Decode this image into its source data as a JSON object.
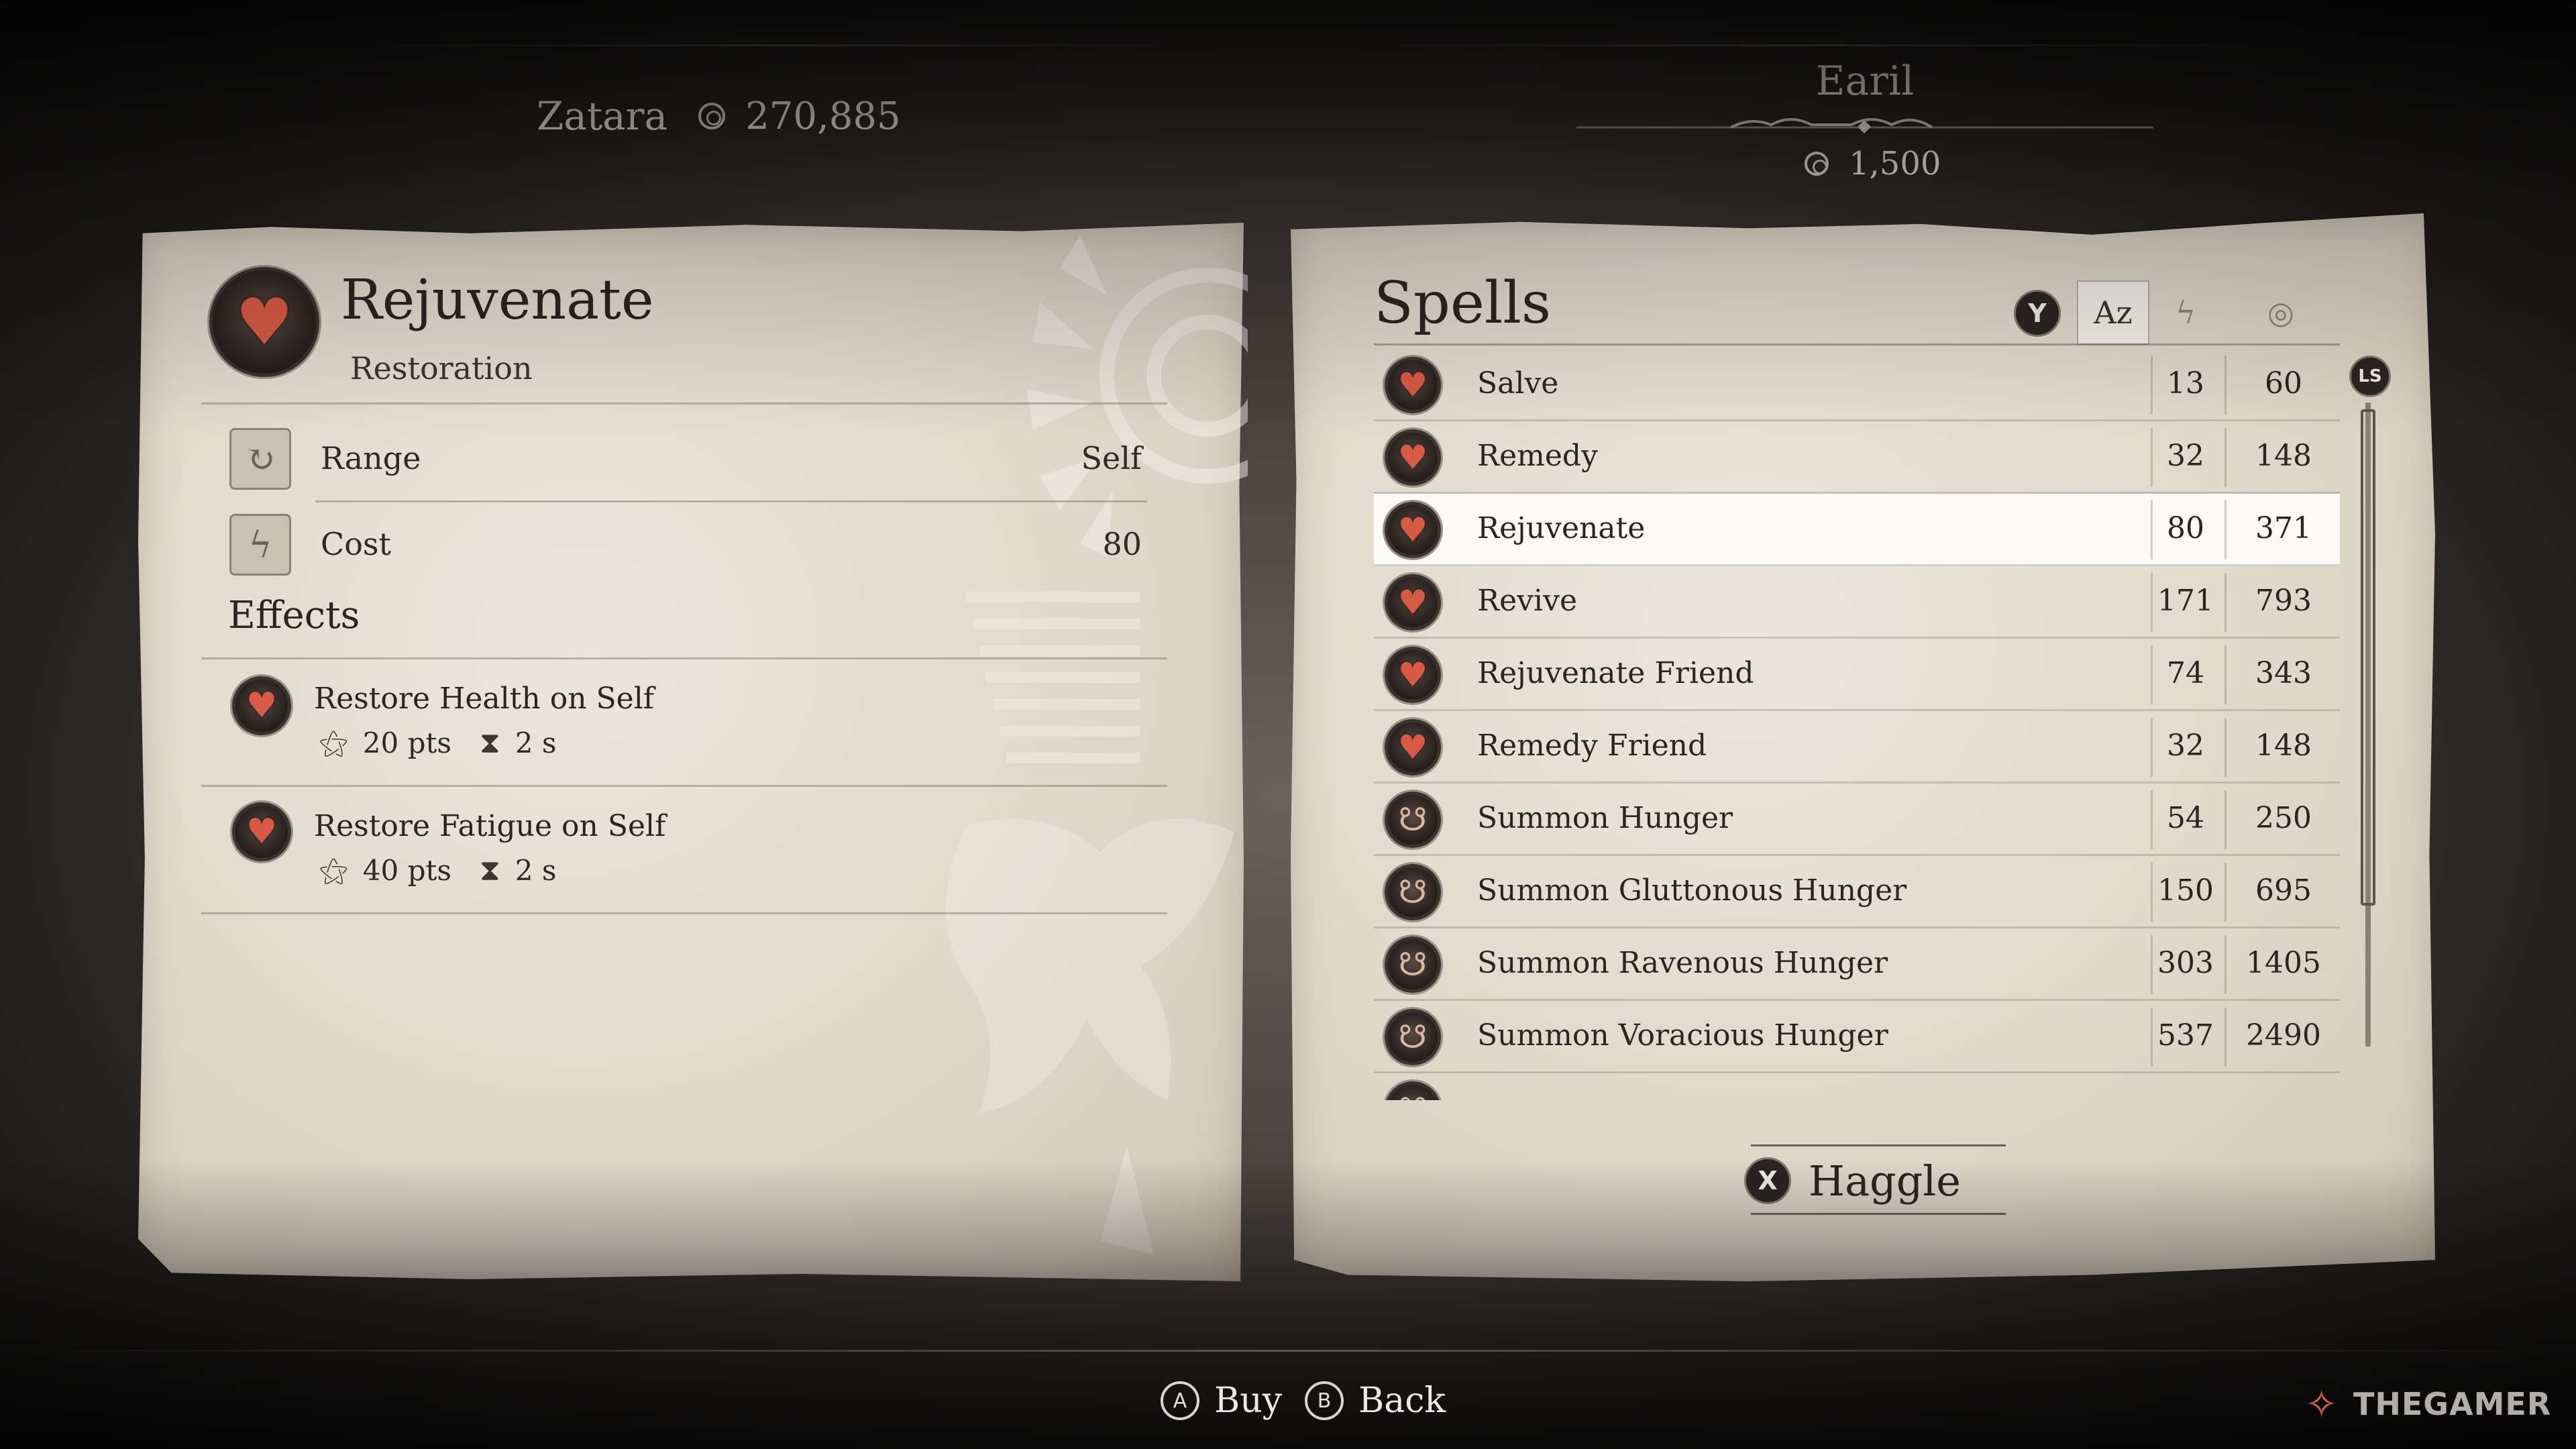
{
  "player": {
    "name": "Zatara",
    "gold": "270,885"
  },
  "merchant": {
    "name": "Earil",
    "gold": "1,500"
  },
  "selected_spell": {
    "name": "Rejuvenate",
    "school": "Restoration",
    "attributes": [
      {
        "label": "Range",
        "value": "Self",
        "icon": "range-icon"
      },
      {
        "label": "Cost",
        "value": "80",
        "icon": "lightning-icon"
      }
    ],
    "effects_heading": "Effects",
    "effects": [
      {
        "name": "Restore Health on Self",
        "magnitude": "20 pts",
        "duration": "2 s"
      },
      {
        "name": "Restore Fatigue on Self",
        "magnitude": "40 pts",
        "duration": "2 s"
      }
    ]
  },
  "spell_list": {
    "title": "Spells",
    "sort_button": "Y",
    "sort_tabs": [
      {
        "icon": "sort-alpha-icon",
        "glyph": "Az",
        "active": true
      },
      {
        "icon": "lightning-icon",
        "glyph": "ϟ",
        "active": false
      },
      {
        "icon": "coin-icon",
        "glyph": "◎",
        "active": false
      }
    ],
    "scroll_button": "LS",
    "rows": [
      {
        "name": "Salve",
        "cost": "13",
        "price": "60",
        "icon": "heart-icon"
      },
      {
        "name": "Remedy",
        "cost": "32",
        "price": "148",
        "icon": "heart-icon"
      },
      {
        "name": "Rejuvenate",
        "cost": "80",
        "price": "371",
        "icon": "heart-icon",
        "selected": true
      },
      {
        "name": "Revive",
        "cost": "171",
        "price": "793",
        "icon": "heart-icon"
      },
      {
        "name": "Rejuvenate Friend",
        "cost": "74",
        "price": "343",
        "icon": "heart-icon"
      },
      {
        "name": "Remedy Friend",
        "cost": "32",
        "price": "148",
        "icon": "heart-icon"
      },
      {
        "name": "Summon Hunger",
        "cost": "54",
        "price": "250",
        "icon": "summon-icon"
      },
      {
        "name": "Summon Gluttonous Hunger",
        "cost": "150",
        "price": "695",
        "icon": "summon-icon"
      },
      {
        "name": "Summon Ravenous Hunger",
        "cost": "303",
        "price": "1405",
        "icon": "summon-icon"
      },
      {
        "name": "Summon Voracious Hunger",
        "cost": "537",
        "price": "2490",
        "icon": "summon-icon"
      }
    ]
  },
  "haggle": {
    "button": "X",
    "label": "Haggle"
  },
  "prompts": [
    {
      "button": "A",
      "label": "Buy"
    },
    {
      "button": "B",
      "label": "Back"
    }
  ],
  "watermark": "THEGAMER"
}
